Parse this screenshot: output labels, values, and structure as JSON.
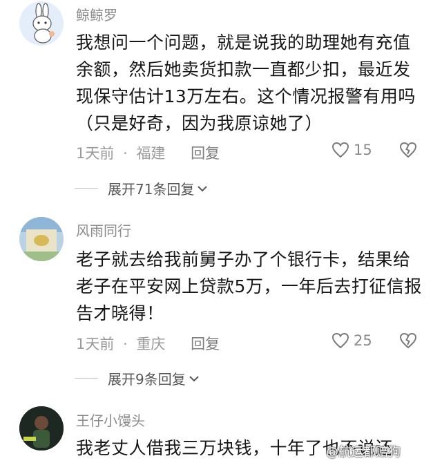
{
  "comments": [
    {
      "username": "鲸鲸罗",
      "text": "我想问一个问题，就是说我的助理她有充值余额，然后她卖货扣款一直都少扣，最近发现保守估计13万左右。这个情况报警有用吗 （只是好奇，因为我原谅她了）",
      "time": "1天前",
      "location": "福建",
      "reply_label": "回复",
      "likes": "15",
      "expand_label": "展开71条回复"
    },
    {
      "username": "风雨同行",
      "text": "老子就去给我前舅子办了个银行卡，结果给老子在平安网上贷款5万，一年后去打征信报告才晓得！",
      "time": "1天前",
      "location": "重庆",
      "reply_label": "回复",
      "likes": "25",
      "expand_label": "展开9条回复"
    },
    {
      "username": "王仔小馒头",
      "text": "我老丈人借我三万块钱，十年了也不说还"
    }
  ],
  "separator": "·",
  "watermark": "@航运都赔狗",
  "icons": {
    "like": "heart-outline-icon",
    "dislike": "broken-heart-icon",
    "expand": "chevron-down-icon"
  }
}
